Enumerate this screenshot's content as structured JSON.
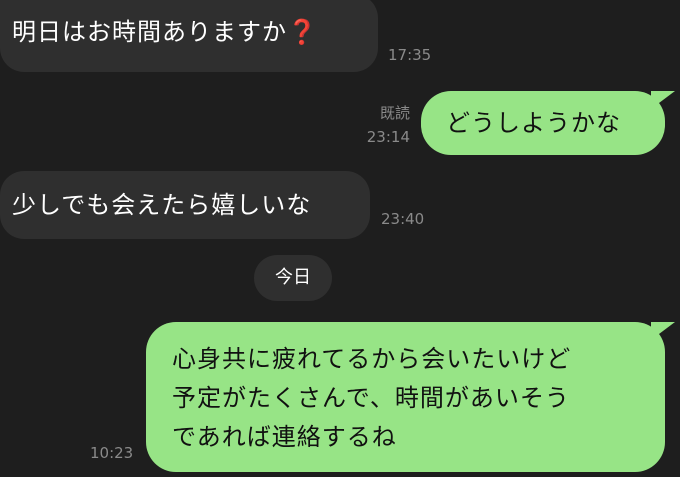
{
  "messages": [
    {
      "direction": "received",
      "text": "明日はお時間ありますか",
      "emoji": "❓",
      "time": "17:35"
    },
    {
      "direction": "sent",
      "text": "どうしようかな",
      "read_label": "既読",
      "time": "23:14"
    },
    {
      "direction": "received",
      "text": "少しでも会えたら嬉しいな",
      "time": "23:40"
    },
    {
      "direction": "sent",
      "lines": [
        "心身共に疲れてるから会いたいけど",
        "予定がたくさんで、時間があいそう",
        "であれば連絡するね"
      ],
      "time": "10:23"
    }
  ],
  "date_separator": "今日",
  "colors": {
    "background": "#1e1e1e",
    "received_bubble": "#2f2f2f",
    "sent_bubble": "#97e486",
    "meta_text": "#8a8a8a"
  }
}
